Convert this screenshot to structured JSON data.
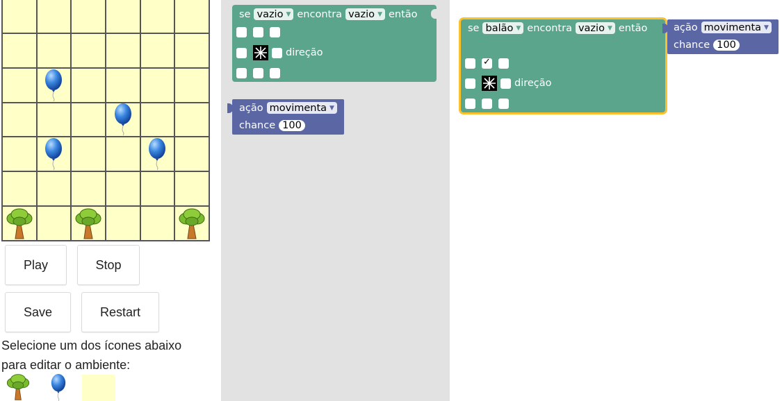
{
  "environment": {
    "rows": [
      [
        "empty",
        "empty",
        "empty",
        "empty",
        "empty",
        "empty"
      ],
      [
        "empty",
        "empty",
        "empty",
        "empty",
        "empty",
        "empty"
      ],
      [
        "empty",
        "balloon",
        "empty",
        "empty",
        "empty",
        "empty"
      ],
      [
        "empty",
        "empty",
        "empty",
        "balloon",
        "empty",
        "empty"
      ],
      [
        "empty",
        "balloon",
        "empty",
        "empty",
        "balloon",
        "empty"
      ],
      [
        "empty",
        "empty",
        "empty",
        "empty",
        "empty",
        "empty"
      ],
      [
        "tree",
        "empty",
        "tree",
        "empty",
        "empty",
        "tree"
      ]
    ],
    "cell_color": "#ffffc8",
    "grid_line_color": "#555555"
  },
  "controls": {
    "play_label": "Play",
    "stop_label": "Stop",
    "save_label": "Save",
    "restart_label": "Restart"
  },
  "instructions": {
    "line1": "Selecione um dos ícones abaixo",
    "line2": "para editar o ambiente:"
  },
  "palette": [
    "tree-icon",
    "balloon-icon",
    "empty-cell"
  ],
  "toolbox": {
    "if_block": {
      "word_if": "se",
      "subject": "vazio",
      "word_finds": "encontra",
      "target": "vazio",
      "word_then": "então",
      "direction_label": "direção"
    },
    "action_block": {
      "word_action": "ação",
      "action": "movimenta",
      "word_chance": "chance",
      "chance": "100"
    }
  },
  "workspace": {
    "if_block": {
      "word_if": "se",
      "subject": "balão",
      "word_finds": "encontra",
      "target": "vazio",
      "word_then": "então",
      "direction_label": "direção",
      "checked_cell": "top-center"
    },
    "action_block": {
      "word_action": "ação",
      "action": "movimenta",
      "word_chance": "chance",
      "chance": "100"
    }
  },
  "colors": {
    "logic_block": "#5ba58c",
    "action_block": "#5b67a5",
    "selection_outline": "#fbc02d",
    "toolbox_bg": "#e2e2e2"
  }
}
